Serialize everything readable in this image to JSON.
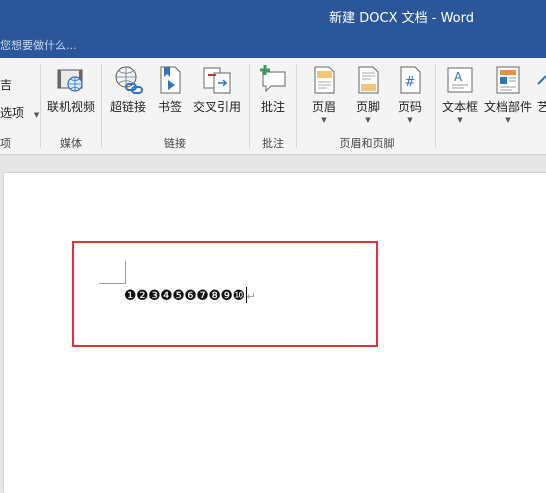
{
  "title": "新建 DOCX 文档 - Word",
  "tell_me": "您想要做什么...",
  "ribbon": {
    "partial_left": {
      "top": "吉",
      "mid": "选项",
      "bottom": "项"
    },
    "groups": [
      {
        "label": "媒体",
        "buttons": [
          {
            "label": "联机视频",
            "icon": "online-video-icon"
          }
        ]
      },
      {
        "label": "链接",
        "buttons": [
          {
            "label": "超链接",
            "icon": "hyperlink-icon"
          },
          {
            "label": "书签",
            "icon": "bookmark-icon"
          },
          {
            "label": "交叉引用",
            "icon": "cross-reference-icon"
          }
        ]
      },
      {
        "label": "批注",
        "buttons": [
          {
            "label": "批注",
            "icon": "comment-icon"
          }
        ]
      },
      {
        "label": "页眉和页脚",
        "buttons": [
          {
            "label": "页眉",
            "icon": "header-icon"
          },
          {
            "label": "页脚",
            "icon": "footer-icon"
          },
          {
            "label": "页码",
            "icon": "page-number-icon"
          }
        ]
      },
      {
        "label": "",
        "buttons": [
          {
            "label": "文本框",
            "icon": "text-box-icon"
          },
          {
            "label": "文档部件",
            "icon": "quick-parts-icon"
          },
          {
            "label": "艺",
            "icon": "wordart-icon"
          }
        ]
      }
    ]
  },
  "document": {
    "content": "❶❷❸❹❺❻❼❽❾❿",
    "paragraph_mark": "↵"
  },
  "colors": {
    "titlebar": "#2b579a",
    "ribbon": "#f4f4f4",
    "highlight": "#d9353a"
  }
}
